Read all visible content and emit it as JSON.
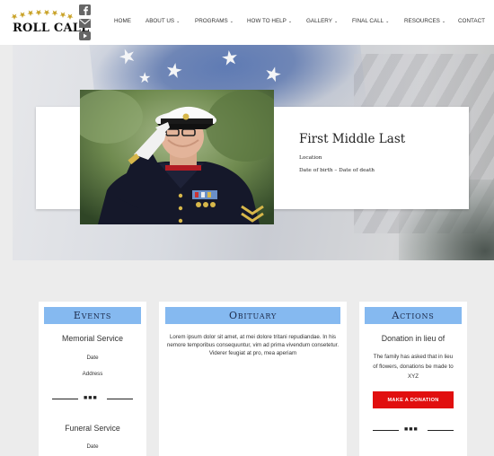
{
  "brand": {
    "logo_text": "ROLL CALL",
    "logo_icon": "stars-arc-icon"
  },
  "social": [
    {
      "icon": "facebook-icon"
    },
    {
      "icon": "email-icon"
    },
    {
      "icon": "youtube-icon"
    }
  ],
  "nav": [
    {
      "label": "HOME",
      "dropdown": false
    },
    {
      "label": "ABOUT US",
      "dropdown": true
    },
    {
      "label": "PROGRAMS",
      "dropdown": true
    },
    {
      "label": "HOW TO HELP",
      "dropdown": true
    },
    {
      "label": "GALLERY",
      "dropdown": true
    },
    {
      "label": "FINAL CALL",
      "dropdown": true
    },
    {
      "label": "RESOURCES",
      "dropdown": true
    },
    {
      "label": "CONTACT",
      "dropdown": false
    }
  ],
  "profile": {
    "name": "First Middle Last",
    "location": "Location",
    "dates": "Date of birth – Date of death"
  },
  "events": {
    "heading": "Events",
    "items": [
      {
        "title": "Memorial Service",
        "date": "Date",
        "address": "Address"
      },
      {
        "title": "Funeral Service",
        "date": "Date"
      }
    ]
  },
  "obituary": {
    "heading": "Obituary",
    "text": "Lorem ipsum dolor sit amet, at mei dolore tritani repudiandae. In his nemore temporibus consequuntur, vim ad prima vivendum consetetur. Viderer feugiat at pro, mea aperiam"
  },
  "actions": {
    "heading": "Actions",
    "title": "Donation in lieu of",
    "text_lines": [
      "The family has asked that in lieu",
      "of flowers, donations be made to",
      "XYZ"
    ],
    "button": "MAKE A DONATION"
  },
  "colors": {
    "panel_header": "#85b9f0",
    "donate_button": "#e10f0f",
    "logo_star": "#c9a227"
  }
}
